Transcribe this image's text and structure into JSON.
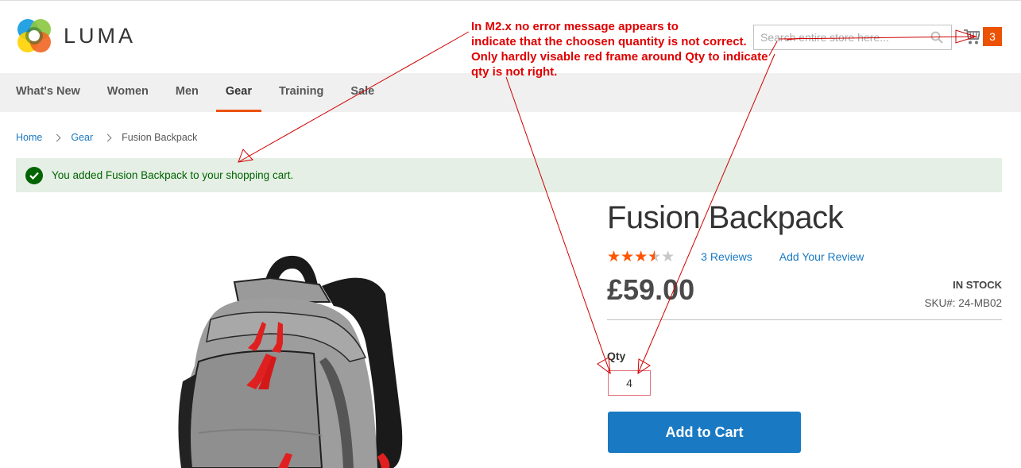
{
  "header": {
    "logo_text": "LUMA",
    "search": {
      "placeholder": "Search entire store here...",
      "value": ""
    },
    "cart": {
      "icon": "shopping-cart-icon",
      "count": "3",
      "count_color": "#eb5202"
    }
  },
  "nav": {
    "items": [
      {
        "label": "What's New",
        "active": false
      },
      {
        "label": "Women",
        "active": false
      },
      {
        "label": "Men",
        "active": false
      },
      {
        "label": "Gear",
        "active": true
      },
      {
        "label": "Training",
        "active": false
      },
      {
        "label": "Sale",
        "active": false
      }
    ],
    "active_color": "#eb5202"
  },
  "breadcrumb": {
    "items": [
      {
        "label": "Home",
        "link": true
      },
      {
        "label": "Gear",
        "link": true
      },
      {
        "label": "Fusion Backpack",
        "link": false
      }
    ]
  },
  "message": {
    "type": "success",
    "icon": "check-circle-icon",
    "text": "You added Fusion Backpack to your shopping cart.",
    "color": "#006400",
    "background": "#e5efe5"
  },
  "product": {
    "image_alt": "Fusion Backpack",
    "title": "Fusion Backpack",
    "rating": {
      "value": 3.5,
      "max": 5,
      "color": "#ff5501"
    },
    "reviews_label": "3  Reviews",
    "add_review_label": "Add Your Review",
    "price": "£59.00",
    "stock": "IN STOCK",
    "sku": "SKU#:  24-MB02",
    "qty_label": "Qty",
    "qty_value": "4",
    "add_to_cart_label": "Add to Cart",
    "button_color": "#1979c3"
  },
  "annotation": {
    "text": "In M2.x no error message appears to\nindicate that the choosen quantity is not correct.\nOnly hardly visable red frame around Qty to indicate\nqty is not right.",
    "color": "#e00000"
  }
}
